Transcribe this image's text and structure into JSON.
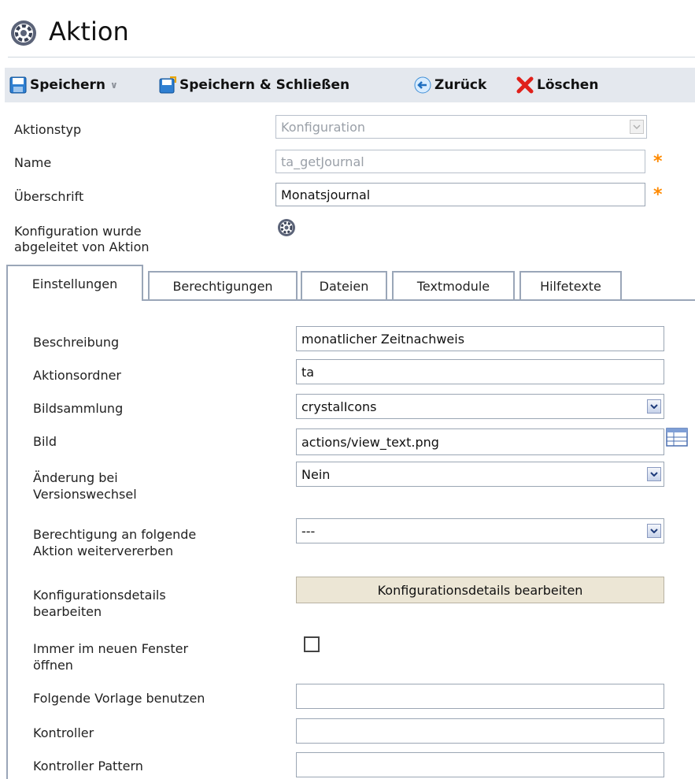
{
  "page": {
    "title": "Aktion"
  },
  "toolbar": {
    "save_label": "Speichern",
    "save_close_label": "Speichern & Schließen",
    "back_label": "Zurück",
    "delete_label": "Löschen"
  },
  "header_form": {
    "action_type": {
      "label": "Aktionstyp",
      "value": "Konfiguration"
    },
    "name": {
      "label": "Name",
      "value": "ta_getJournal"
    },
    "heading": {
      "label": "Überschrift",
      "value": "Monatsjournal"
    },
    "derived": {
      "label_line1": "Konfiguration wurde",
      "label_line2": "abgeleitet von Aktion"
    },
    "required_mark": "*"
  },
  "tabs": [
    {
      "label": "Einstellungen",
      "active": true
    },
    {
      "label": "Berechtigungen",
      "active": false
    },
    {
      "label": "Dateien",
      "active": false
    },
    {
      "label": "Textmodule",
      "active": false
    },
    {
      "label": "Hilfetexte",
      "active": false
    }
  ],
  "settings": {
    "description": {
      "label": "Beschreibung",
      "value": "monatlicher Zeitnachweis"
    },
    "action_folder": {
      "label": "Aktionsordner",
      "value": "ta"
    },
    "image_collection": {
      "label": "Bildsammlung",
      "value": "crystalIcons"
    },
    "image": {
      "label": "Bild",
      "value": "actions/view_text.png"
    },
    "version_change": {
      "label_line1": "Änderung bei",
      "label_line2": "Versionswechsel",
      "value": "Nein"
    },
    "inherit_permission": {
      "label_line1": "Berechtigung an folgende",
      "label_line2": "Aktion weitervererben",
      "value": "---"
    },
    "config_details": {
      "label_line1": "Konfigurationsdetails",
      "label_line2": "bearbeiten",
      "button": "Konfigurationsdetails bearbeiten"
    },
    "new_window": {
      "label_line1": "Immer im neuen Fenster",
      "label_line2": "öffnen",
      "checked": false
    },
    "template": {
      "label": "Folgende Vorlage benutzen",
      "value": ""
    },
    "controller": {
      "label": "Kontroller",
      "value": ""
    },
    "controller_pattern": {
      "label": "Kontroller Pattern",
      "value": ""
    }
  },
  "colors": {
    "toolbar_bg": "#e4e8ee",
    "required": "#ff8a00",
    "button_bg": "#ece6d5",
    "tab_border": "#9aa6b8"
  }
}
